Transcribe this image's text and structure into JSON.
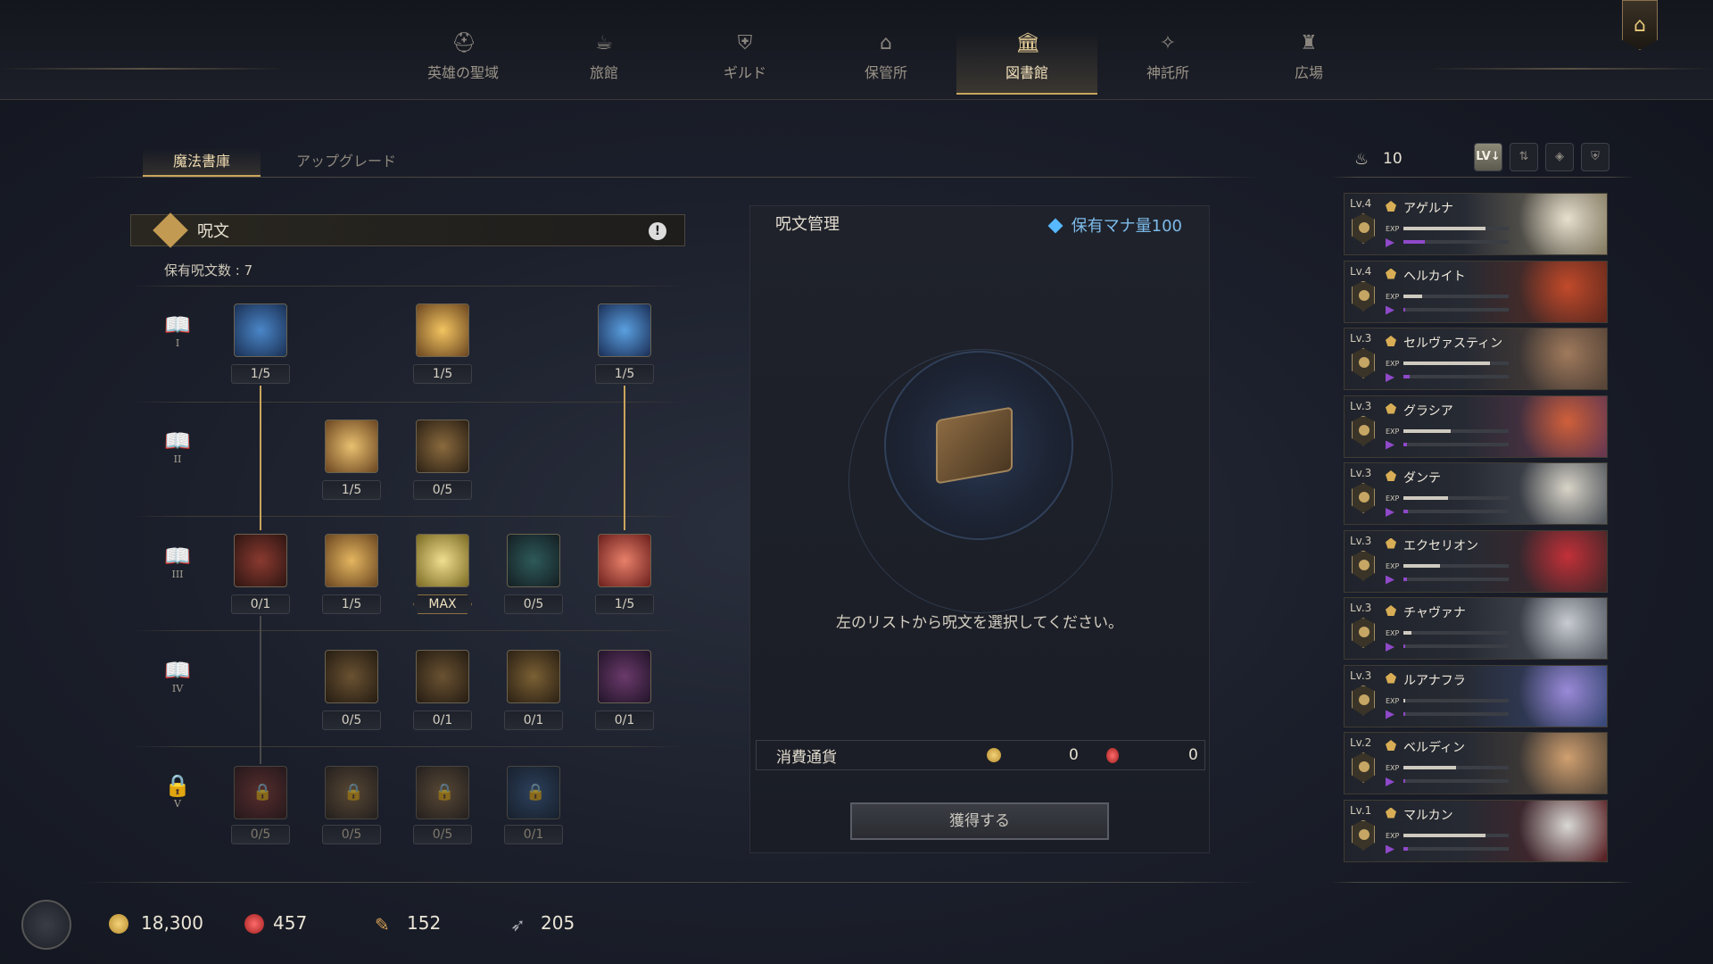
{
  "nav": {
    "items": [
      {
        "label": "英雄の聖域",
        "icon": "helmet-icon"
      },
      {
        "label": "旅館",
        "icon": "mug-icon"
      },
      {
        "label": "ギルド",
        "icon": "shield-icon"
      },
      {
        "label": "保管所",
        "icon": "vault-icon"
      },
      {
        "label": "図書館",
        "icon": "library-icon",
        "active": true
      },
      {
        "label": "神託所",
        "icon": "oracle-icon"
      },
      {
        "label": "広場",
        "icon": "statue-icon"
      }
    ]
  },
  "tabs": [
    "魔法書庫",
    "アップグレード"
  ],
  "spells": {
    "title": "呪文",
    "owned_label": "保有呪文数 : 7",
    "tiers": [
      "I",
      "II",
      "III",
      "IV",
      "V"
    ],
    "tier1": [
      "1/5",
      "1/5",
      "1/5"
    ],
    "tier2": [
      "1/5",
      "0/5"
    ],
    "tier3": [
      "0/1",
      "1/5",
      "MAX",
      "0/5",
      "1/5"
    ],
    "tier4": [
      "0/5",
      "0/1",
      "0/1",
      "0/1"
    ],
    "tier5": [
      "0/5",
      "0/5",
      "0/5",
      "0/1"
    ]
  },
  "manage": {
    "title": "呪文管理",
    "mana": "保有マナ量100",
    "prompt": "左のリストから呪文を選択してください。",
    "cost_label": "消費通貨",
    "cost_gold": "0",
    "cost_ruby": "0",
    "acquire": "獲得する"
  },
  "heroes": {
    "count": "10",
    "sort_label": "LV↓",
    "list": [
      {
        "lv": "Lv.4",
        "name": "アゲルナ",
        "exp": 0.78,
        "mana": 0.2,
        "color": "#8a8066",
        "portrait": "#e8e0cf"
      },
      {
        "lv": "Lv.4",
        "name": "ヘルカイト",
        "exp": 0.18,
        "mana": 0.02,
        "color": "#6a2a1c",
        "portrait": "#c24a2a"
      },
      {
        "lv": "Lv.3",
        "name": "セルヴァスティン",
        "exp": 0.82,
        "mana": 0.06,
        "color": "#5a4638",
        "portrait": "#a07a5c"
      },
      {
        "lv": "Lv.3",
        "name": "グラシア",
        "exp": 0.45,
        "mana": 0.03,
        "color": "#6a3850",
        "portrait": "#d0603a"
      },
      {
        "lv": "Lv.3",
        "name": "ダンテ",
        "exp": 0.42,
        "mana": 0.04,
        "color": "#55595f",
        "portrait": "#d8d4c8"
      },
      {
        "lv": "Lv.3",
        "name": "エクセリオン",
        "exp": 0.35,
        "mana": 0.03,
        "color": "#4a2628",
        "portrait": "#c23038"
      },
      {
        "lv": "Lv.3",
        "name": "チャヴァナ",
        "exp": 0.08,
        "mana": 0.02,
        "color": "#585d66",
        "portrait": "#c8ccd2"
      },
      {
        "lv": "Lv.3",
        "name": "ルアナフラ",
        "exp": 0.02,
        "mana": 0.02,
        "color": "#3a4a7a",
        "portrait": "#9a8ad8"
      },
      {
        "lv": "Lv.2",
        "name": "ベルディン",
        "exp": 0.5,
        "mana": 0.02,
        "color": "#5a4a3a",
        "portrait": "#d0a070"
      },
      {
        "lv": "Lv.1",
        "name": "マルカン",
        "exp": 0.78,
        "mana": 0.04,
        "color": "#5a2226",
        "portrait": "#d8d8d4"
      }
    ]
  },
  "resources": {
    "gold": "18,300",
    "ruby": "457",
    "scroll": "152",
    "feather": "205"
  }
}
